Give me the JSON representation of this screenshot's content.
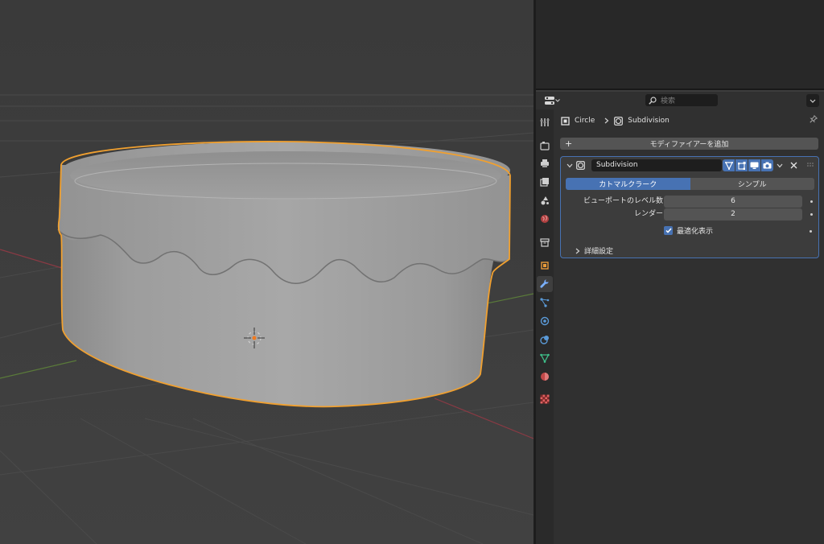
{
  "properties_header": {
    "search_placeholder": "検索",
    "editor_type_icon": "properties-editor-icon"
  },
  "breadcrumb": {
    "object_name": "Circle",
    "separator": ">",
    "modifier_name": "Subdivision"
  },
  "add_modifier_label": "モディファイアーを追加",
  "modifier": {
    "name": "Subdivision",
    "type_icon": "subdivision-modifier-icon",
    "toggles": [
      "on-cage-icon",
      "edit-mode-icon",
      "viewport-display-icon",
      "render-camera-icon"
    ],
    "mode_options": [
      "カトマルクラーク",
      "シンプル"
    ],
    "mode_selected": "カトマルクラーク",
    "levels_viewport_label": "ビューポートのレベル数",
    "levels_viewport_value": "6",
    "render_label": "レンダー",
    "render_value": "2",
    "optimal_display_label": "最適化表示",
    "optimal_display_checked": true,
    "advanced_label": "詳細設定"
  },
  "tabs": [
    "tool-icon",
    "render-icon",
    "output-icon",
    "view-layer-icon",
    "scene-icon",
    "world-icon",
    "collection-icon",
    "object-icon",
    "modifier-wrench-icon",
    "particles-icon",
    "physics-icon",
    "constraints-icon",
    "object-data-icon",
    "material-icon",
    "texture-icon"
  ],
  "colors": {
    "accent": "#4772b3",
    "selection_outline": "#f0a030",
    "x_axis": "#a83a45",
    "y_axis": "#6a9a3a"
  }
}
